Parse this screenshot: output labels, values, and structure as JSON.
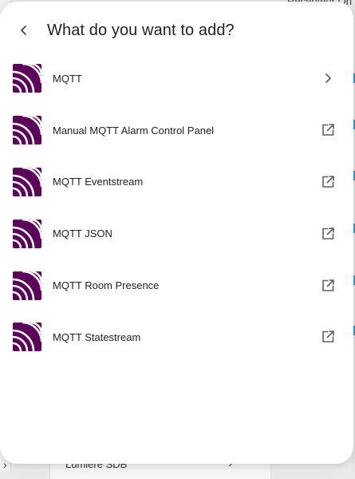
{
  "background": {
    "top_text": "Récepteur On",
    "bottom_text": "Lumière SDB"
  },
  "dialog": {
    "title": "What do you want to add?",
    "back_icon": "chevron-left-icon",
    "accent_color": "#5c005c"
  },
  "items": [
    {
      "label": "MQTT",
      "trailing_icon": "chevron-right-icon"
    },
    {
      "label": "Manual MQTT Alarm Control Panel",
      "trailing_icon": "open-in-new-icon"
    },
    {
      "label": "MQTT Eventstream",
      "trailing_icon": "open-in-new-icon"
    },
    {
      "label": "MQTT JSON",
      "trailing_icon": "open-in-new-icon"
    },
    {
      "label": "MQTT Room Presence",
      "trailing_icon": "open-in-new-icon"
    },
    {
      "label": "MQTT Statestream",
      "trailing_icon": "open-in-new-icon"
    }
  ]
}
